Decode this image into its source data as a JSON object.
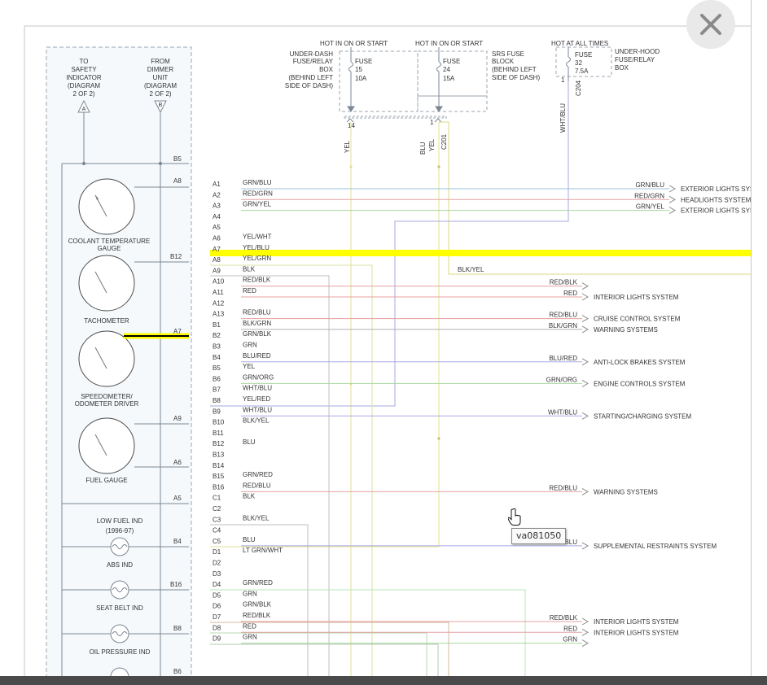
{
  "left_col": {
    "a_text": [
      "TO",
      "SAFETY",
      "INDICATOR",
      "(DIAGRAM",
      "2 OF 2)"
    ],
    "b_text": [
      "FROM",
      "DIMMER",
      "UNIT",
      "(DIAGRAM",
      "2 OF 2)"
    ],
    "a_marker": "A",
    "b_marker": "B"
  },
  "gauges": [
    {
      "label": [
        "COOLANT TEMPERATURE",
        "GAUGE"
      ],
      "pin": "A8"
    },
    {
      "label": [
        "TACHOMETER"
      ],
      "pin": "B12"
    },
    {
      "label": [
        "SPEEDOMETER/",
        "ODOMETER DRIVER"
      ],
      "pin": "A7"
    },
    {
      "label": [
        "FUEL GAUGE"
      ],
      "pin": "A9"
    }
  ],
  "lamps": [
    {
      "label": [
        "LOW FUEL IND",
        "(1996-97)"
      ],
      "pin": "B4"
    },
    {
      "label": [
        "ABS IND"
      ],
      "pin": "B16"
    },
    {
      "label": [
        "SEAT BELT IND"
      ],
      "pin": "B8"
    },
    {
      "label": [
        "OIL PRESSURE IND"
      ],
      "pin": "B6"
    }
  ],
  "extra_pins": {
    "b5": "B5",
    "a6": "A6",
    "a5": "A5"
  },
  "top": {
    "hot1": "HOT IN ON OR START",
    "hot2": "HOT IN ON OR START",
    "hot3": "HOT AT ALL TIMES",
    "box1": [
      "UNDER-DASH",
      "FUSE/RELAY",
      "BOX",
      "(BEHIND LEFT",
      "SIDE OF DASH)"
    ],
    "fuse1": [
      "FUSE",
      "15",
      "10A"
    ],
    "fuse2": [
      "FUSE",
      "24",
      "15A"
    ],
    "box2": [
      "SRS FUSE",
      "BLOCK",
      "(BEHIND LEFT",
      "SIDE OF DASH)"
    ],
    "fuse3": [
      "FUSE",
      "32",
      "7.5A"
    ],
    "box3": [
      "UNDER-HOOD",
      "FUSE/RELAY",
      "BOX"
    ],
    "pin14": "14",
    "pin1a": "1",
    "pin1b": "1",
    "c_a": "C201",
    "c_b": "C204",
    "w_yel1": "YEL",
    "w_yel2": "YEL",
    "w_blu": "BLU",
    "w_wht": "WHT/BLU"
  },
  "rows": [
    {
      "pin": "A1",
      "color": "GRN/BLU"
    },
    {
      "pin": "A2",
      "color": "RED/GRN"
    },
    {
      "pin": "A3",
      "color": "GRN/YEL"
    },
    {
      "pin": "A4",
      "color": ""
    },
    {
      "pin": "A5",
      "color": ""
    },
    {
      "pin": "A6",
      "color": "YEL/WHT"
    },
    {
      "pin": "A7",
      "color": "YEL/BLU"
    },
    {
      "pin": "A8",
      "color": "YEL/GRN"
    },
    {
      "pin": "A9",
      "color": "BLK"
    },
    {
      "pin": "A10",
      "color": "RED/BLK"
    },
    {
      "pin": "A11",
      "color": "RED"
    },
    {
      "pin": "A12",
      "color": ""
    },
    {
      "pin": "A13",
      "color": "RED/BLU"
    },
    {
      "pin": "B1",
      "color": "BLK/GRN"
    },
    {
      "pin": "B2",
      "color": "GRN/BLK"
    },
    {
      "pin": "B3",
      "color": "GRN"
    },
    {
      "pin": "B4",
      "color": "BLU/RED"
    },
    {
      "pin": "B5",
      "color": "YEL"
    },
    {
      "pin": "B6",
      "color": "GRN/ORG"
    },
    {
      "pin": "B7",
      "color": "WHT/BLU"
    },
    {
      "pin": "B8",
      "color": "YEL/RED"
    },
    {
      "pin": "B9",
      "color": "WHT/BLU"
    },
    {
      "pin": "B10",
      "color": "BLK/YEL"
    },
    {
      "pin": "B11",
      "color": ""
    },
    {
      "pin": "B12",
      "color": "BLU"
    },
    {
      "pin": "B13",
      "color": ""
    },
    {
      "pin": "B14",
      "color": ""
    },
    {
      "pin": "B15",
      "color": "GRN/RED"
    },
    {
      "pin": "B16",
      "color": "RED/BLU"
    },
    {
      "pin": "C1",
      "color": "BLK"
    },
    {
      "pin": "C2",
      "color": ""
    },
    {
      "pin": "C3",
      "color": "BLK/YEL"
    },
    {
      "pin": "C4",
      "color": ""
    },
    {
      "pin": "C5",
      "color": "BLU"
    },
    {
      "pin": "D1",
      "color": "LT GRN/WHT"
    },
    {
      "pin": "D2",
      "color": ""
    },
    {
      "pin": "D3",
      "color": ""
    },
    {
      "pin": "D4",
      "color": "GRN/RED"
    },
    {
      "pin": "D5",
      "color": "GRN"
    },
    {
      "pin": "D6",
      "color": "GRN/BLK"
    },
    {
      "pin": "D7",
      "color": "RED/BLK"
    },
    {
      "pin": "D8",
      "color": "RED"
    },
    {
      "pin": "D9",
      "color": "GRN"
    }
  ],
  "outputs": [
    {
      "row": 0,
      "wire": "GRN/BLU",
      "system": "EXTERIOR LIGHTS SYS"
    },
    {
      "row": 1,
      "wire": "RED/GRN",
      "system": "HEADLIGHTS SYSTEM"
    },
    {
      "row": 2,
      "wire": "GRN/YEL",
      "system": "EXTERIOR LIGHTS SYS"
    },
    {
      "row": 9,
      "wire": "RED/BLK",
      "system": ""
    },
    {
      "row": 10,
      "wire": "RED",
      "system": "INTERIOR LIGHTS SYSTEM"
    },
    {
      "row": 12,
      "wire": "RED/BLU",
      "system": "CRUISE CONTROL SYSTEM"
    },
    {
      "row": 13,
      "wire": "BLK/GRN",
      "system": "WARNING SYSTEMS"
    },
    {
      "row": 16,
      "wire": "BLU/RED",
      "system": "ANTI-LOCK BRAKES SYSTEM"
    },
    {
      "row": 18,
      "wire": "GRN/ORG",
      "system": "ENGINE CONTROLS SYSTEM"
    },
    {
      "row": 21,
      "wire": "WHT/BLU",
      "system": "STARTING/CHARGING SYSTEM"
    },
    {
      "row": 28,
      "wire": "RED/BLU",
      "system": "WARNING SYSTEMS"
    },
    {
      "row": 33,
      "wire": "BLU",
      "system": "SUPPLEMENTAL RESTRAINTS SYSTEM"
    },
    {
      "row": 40,
      "wire": "RED/BLK",
      "system": "INTERIOR LIGHTS SYSTEM"
    },
    {
      "row": 41,
      "wire": "RED",
      "system": "INTERIOR LIGHTS SYSTEM"
    },
    {
      "row": 42,
      "wire": "GRN",
      "system": ""
    }
  ],
  "mid_label": "BLK/YEL",
  "tooltip": "va081050",
  "colors": {
    "highlight": "#ffff00",
    "line": "#7b8794",
    "panel": "#f5f9fc"
  }
}
